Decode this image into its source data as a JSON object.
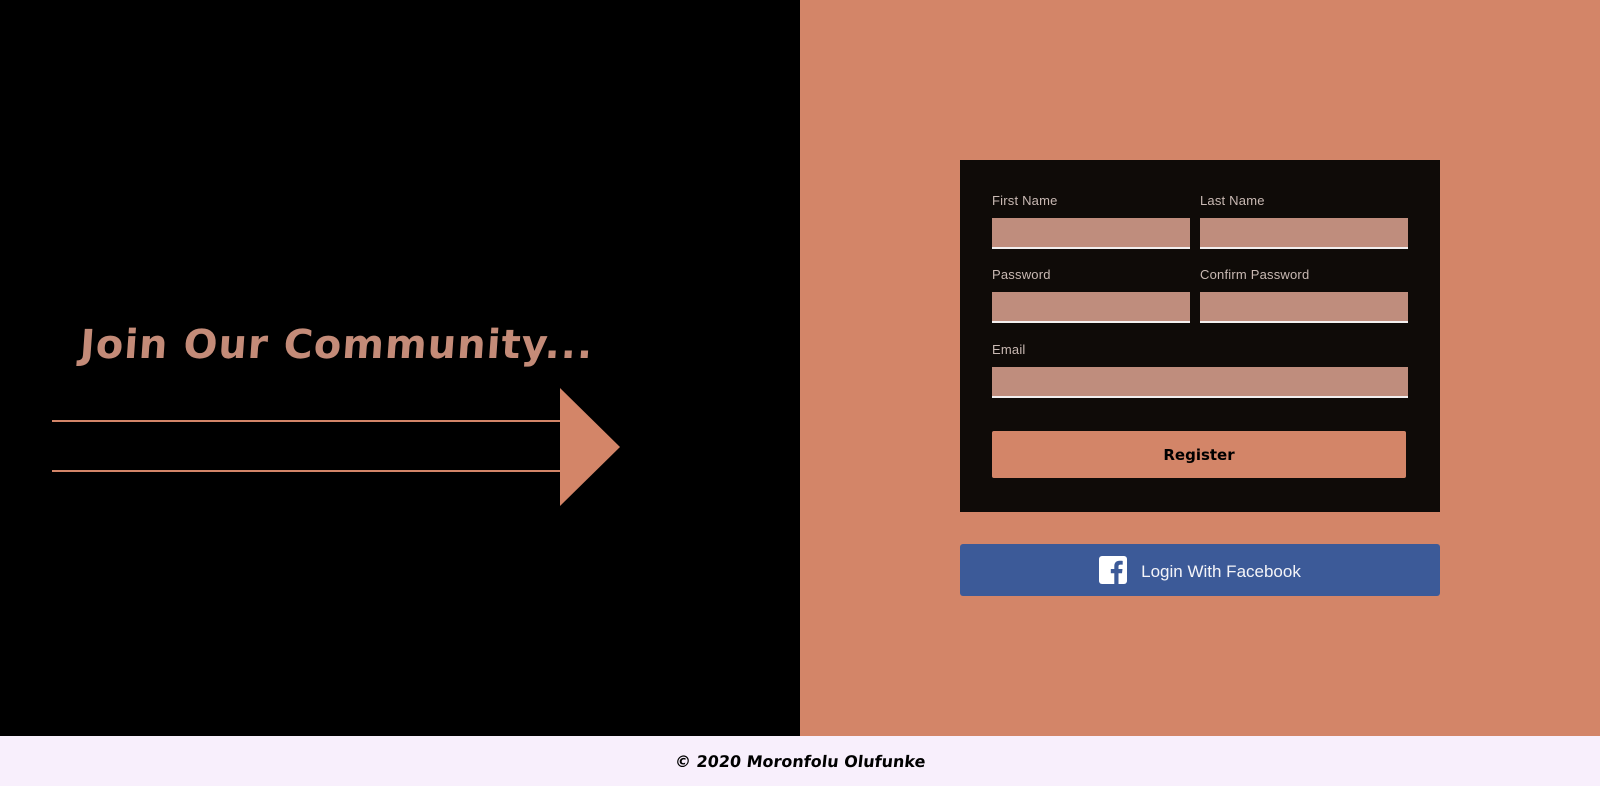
{
  "colors": {
    "left_bg": "#000000",
    "right_bg": "#d38568",
    "accent": "#d38568",
    "headline": "#c48b78",
    "card_bg": "#0f0b08",
    "input_bg": "#bf8d7d",
    "facebook_blue": "#3c5a98",
    "footer_bg": "#f8effc"
  },
  "hero": {
    "headline": "Join Our Community..."
  },
  "form": {
    "first_name_label": "First Name",
    "first_name_value": "",
    "last_name_label": "Last Name",
    "last_name_value": "",
    "password_label": "Password",
    "password_value": "",
    "confirm_password_label": "Confirm Password",
    "confirm_password_value": "",
    "email_label": "Email",
    "email_value": "",
    "register_label": "Register"
  },
  "facebook": {
    "icon": "facebook-icon",
    "label": "Login With Facebook"
  },
  "footer": {
    "text": "© 2020 Moronfolu Olufunke"
  }
}
